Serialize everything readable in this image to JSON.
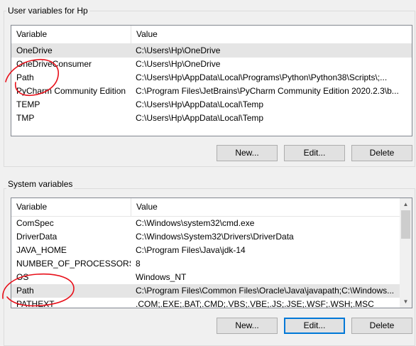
{
  "user_vars": {
    "group_title": "User variables for Hp",
    "headers": {
      "variable": "Variable",
      "value": "Value"
    },
    "rows": [
      {
        "variable": "OneDrive",
        "value": "C:\\Users\\Hp\\OneDrive",
        "selected": true
      },
      {
        "variable": "OneDriveConsumer",
        "value": "C:\\Users\\Hp\\OneDrive"
      },
      {
        "variable": "Path",
        "value": "C:\\Users\\Hp\\AppData\\Local\\Programs\\Python\\Python38\\Scripts\\;..."
      },
      {
        "variable": "PyCharm Community Edition",
        "value": "C:\\Program Files\\JetBrains\\PyCharm Community Edition 2020.2.3\\b..."
      },
      {
        "variable": "TEMP",
        "value": "C:\\Users\\Hp\\AppData\\Local\\Temp"
      },
      {
        "variable": "TMP",
        "value": "C:\\Users\\Hp\\AppData\\Local\\Temp"
      }
    ],
    "buttons": {
      "new": "New...",
      "edit": "Edit...",
      "delete": "Delete"
    }
  },
  "system_vars": {
    "group_title": "System variables",
    "headers": {
      "variable": "Variable",
      "value": "Value"
    },
    "rows": [
      {
        "variable": "ComSpec",
        "value": "C:\\Windows\\system32\\cmd.exe"
      },
      {
        "variable": "DriverData",
        "value": "C:\\Windows\\System32\\Drivers\\DriverData"
      },
      {
        "variable": "JAVA_HOME",
        "value": "C:\\Program Files\\Java\\jdk-14"
      },
      {
        "variable": "NUMBER_OF_PROCESSORS",
        "value": "8"
      },
      {
        "variable": "OS",
        "value": "Windows_NT"
      },
      {
        "variable": "Path",
        "value": "C:\\Program Files\\Common Files\\Oracle\\Java\\javapath;C:\\Windows...",
        "selected": true
      },
      {
        "variable": "PATHEXT",
        "value": ".COM;.EXE;.BAT;.CMD;.VBS;.VBE;.JS;.JSE;.WSF;.WSH;.MSC"
      }
    ],
    "buttons": {
      "new": "New...",
      "edit": "Edit...",
      "delete": "Delete"
    }
  },
  "colors": {
    "annotation": "#e8101a",
    "focus_border": "#0078d7",
    "selected_row": "#e5e5e5"
  }
}
